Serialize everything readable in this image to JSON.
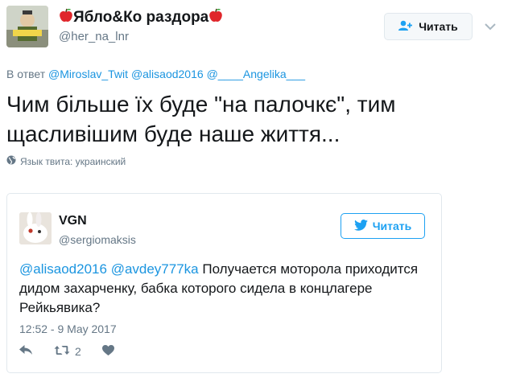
{
  "main_tweet": {
    "display_name": "Яблоко раздора",
    "display_name_prefix": "Ябло&Ко раздора",
    "handle": "@her_na_lnr",
    "follow_label": "Читать",
    "reply_prefix": "В ответ",
    "reply_mentions": [
      "@Miroslav_Twit",
      "@alisaod2016",
      "@____Angelika___"
    ],
    "text": "Чим більше їх буде \"на палочкє\", тим щасливішим буде наше життя...",
    "language_note": "Язык твита: украинский"
  },
  "quoted_tweet": {
    "display_name": "VGN",
    "handle": "@sergiomaksis",
    "follow_label": "Читать",
    "mentions": [
      "@alisaod2016",
      "@avdey777ka"
    ],
    "text": "Получается моторола приходится дидом захарченку, бабка которого сидела в концлагере Рейкьявика?",
    "timestamp": "12:52 - 9 May 2017",
    "retweet_count": "2"
  },
  "colors": {
    "link": "#1b95e0",
    "twitter_blue": "#1da1f2",
    "muted": "#657786",
    "apple_red": "#e0262b"
  },
  "icons": [
    "apple-emoji-icon",
    "add-user-icon",
    "chevron-down-icon",
    "globe-icon",
    "twitter-bird-icon",
    "reply-icon",
    "retweet-icon",
    "like-icon"
  ]
}
